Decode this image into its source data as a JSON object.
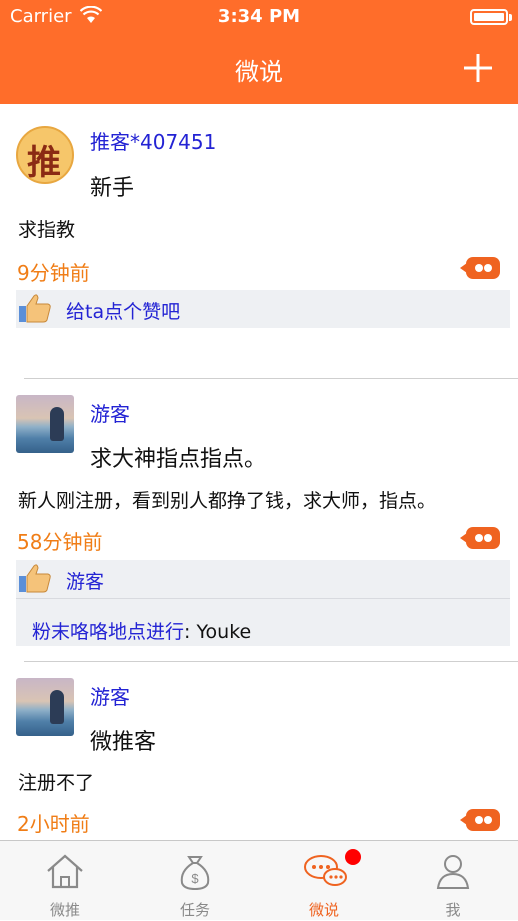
{
  "status_bar": {
    "carrier": "Carrier",
    "time": "3:34 PM"
  },
  "nav": {
    "title": "微说",
    "add_icon": "plus-icon"
  },
  "posts": [
    {
      "username": "推客*407451",
      "avatar_char": "推",
      "title": "新手",
      "body": "求指教",
      "time": "9分钟前",
      "like_text": "给ta点个赞吧",
      "comment": null
    },
    {
      "username": "游客",
      "title": "求大神指点指点。",
      "body": "新人刚注册，看到别人都挣了钱，求大师，指点。",
      "time": "58分钟前",
      "like_text": "游客",
      "comment": {
        "user": "粉末咯咯地点进行",
        "sep": ": ",
        "text": "Youke"
      }
    },
    {
      "username": "游客",
      "title": "微推客",
      "body": "注册不了",
      "time": "2小时前"
    }
  ],
  "tabs": [
    {
      "label": "微推",
      "icon": "home-icon"
    },
    {
      "label": "任务",
      "icon": "money-bag-icon"
    },
    {
      "label": "微说",
      "icon": "chat-bubbles-icon",
      "active": true
    },
    {
      "label": "我",
      "icon": "user-icon"
    }
  ],
  "colors": {
    "accent": "#ff6d2a",
    "link": "#2323d4",
    "time": "#f07d16"
  }
}
